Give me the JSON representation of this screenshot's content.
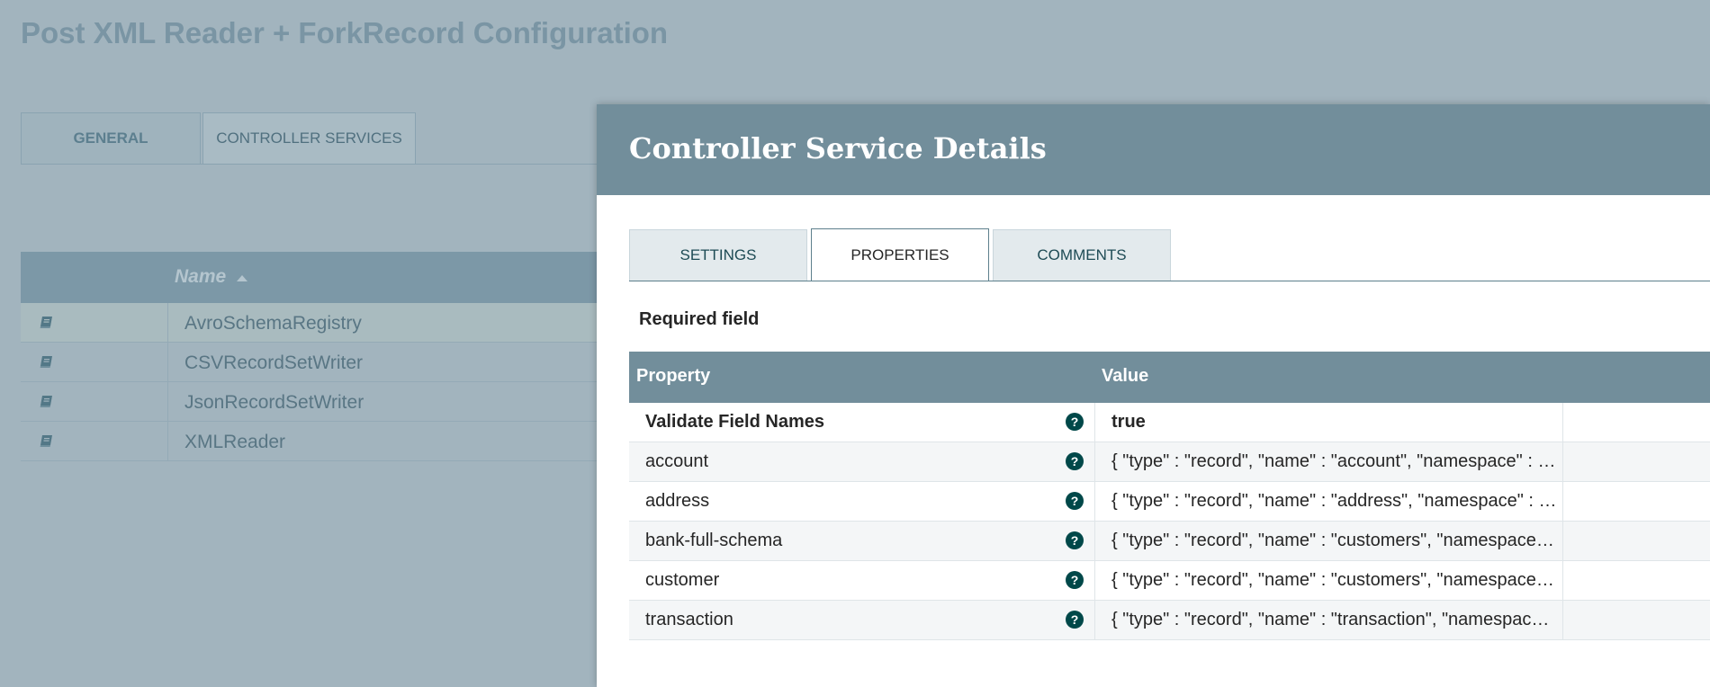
{
  "background": {
    "title": "Post XML Reader + ForkRecord Configuration",
    "tabs": [
      {
        "label": "GENERAL"
      },
      {
        "label": "CONTROLLER SERVICES"
      }
    ],
    "table": {
      "name_header": "Name",
      "rows": [
        {
          "name": "AvroSchemaRegistry"
        },
        {
          "name": "CSVRecordSetWriter"
        },
        {
          "name": "JsonRecordSetWriter"
        },
        {
          "name": "XMLReader"
        }
      ]
    }
  },
  "dialog": {
    "title": "Controller Service Details",
    "tabs": [
      {
        "label": "SETTINGS"
      },
      {
        "label": "PROPERTIES"
      },
      {
        "label": "COMMENTS"
      }
    ],
    "active_tab": "PROPERTIES",
    "required_label": "Required field",
    "properties_table": {
      "headers": {
        "property": "Property",
        "value": "Value"
      },
      "rows": [
        {
          "property": "Validate Field Names",
          "value": "true"
        },
        {
          "property": "account",
          "value": "{ \"type\" : \"record\", \"name\" : \"account\", \"namespace\" : \"bank\", \"fields\" : [ ] }"
        },
        {
          "property": "address",
          "value": "{ \"type\" : \"record\", \"name\" : \"address\", \"namespace\" : \"bank\", \"fields\" : [ ] }"
        },
        {
          "property": "bank-full-schema",
          "value": "{ \"type\" : \"record\", \"name\" : \"customers\", \"namespace\" : \"bank\", \"fields\" : [ ] }"
        },
        {
          "property": "customer",
          "value": "{ \"type\" : \"record\", \"name\" : \"customers\", \"namespace\" : \"bank\", \"fields\" : [ ] }"
        },
        {
          "property": "transaction",
          "value": "{ \"type\" : \"record\", \"name\" : \"transaction\", \"namespace\" : \"bank\", \"fields\" : [ ] }"
        }
      ]
    },
    "help_icon_glyph": "?"
  },
  "colors": {
    "overlay": "#a2b4be",
    "header": "#728e9b",
    "help_icon": "#004849"
  }
}
